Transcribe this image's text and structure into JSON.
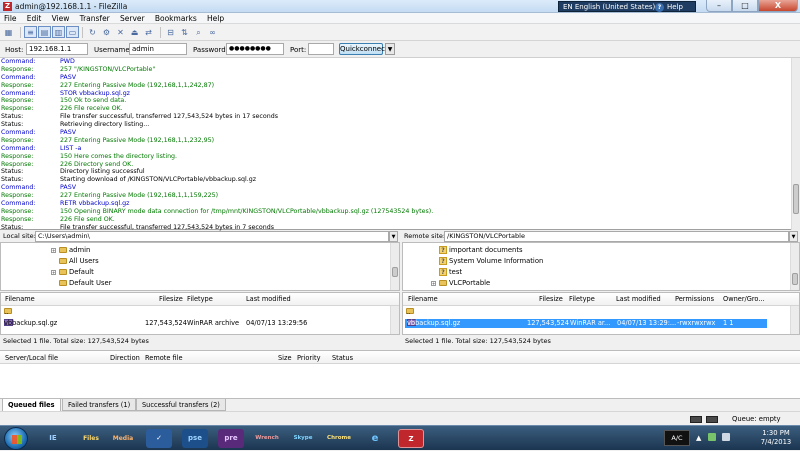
{
  "window": {
    "app_letter": "Z",
    "title": "admin@192.168.1.1 - FileZilla",
    "minimize": "–",
    "maximize": "□",
    "close": "X",
    "language": "EN English (United States)",
    "help": "Help",
    "help_q": "?"
  },
  "menu": [
    "File",
    "Edit",
    "View",
    "Transfer",
    "Server",
    "Bookmarks",
    "Help"
  ],
  "quickconnect": {
    "host_label": "Host:",
    "host": "192.168.1.1",
    "user_label": "Username:",
    "user": "admin",
    "pass_label": "Password:",
    "pass": "●●●●●●●●",
    "port_label": "Port:",
    "port": "",
    "button": "Quickconnect",
    "dropdown": "▼"
  },
  "log": [
    {
      "t": "Command:",
      "m": "PWD",
      "k": "command"
    },
    {
      "t": "Response:",
      "m": "257 \"/KINGSTON/VLCPortable\"",
      "k": "response"
    },
    {
      "t": "Command:",
      "m": "PASV",
      "k": "command"
    },
    {
      "t": "Response:",
      "m": "227 Entering Passive Mode (192,168,1,1,242,87)",
      "k": "response"
    },
    {
      "t": "Command:",
      "m": "STOR vbbackup.sql.gz",
      "k": "command"
    },
    {
      "t": "Response:",
      "m": "150 Ok to send data.",
      "k": "response"
    },
    {
      "t": "Response:",
      "m": "226 File receive OK.",
      "k": "response"
    },
    {
      "t": "Status:",
      "m": "File transfer successful, transferred 127,543,524 bytes in 17 seconds",
      "k": "status"
    },
    {
      "t": "Status:",
      "m": "Retrieving directory listing...",
      "k": "status"
    },
    {
      "t": "Command:",
      "m": "PASV",
      "k": "command"
    },
    {
      "t": "Response:",
      "m": "227 Entering Passive Mode (192,168,1,1,232,95)",
      "k": "response"
    },
    {
      "t": "Command:",
      "m": "LIST -a",
      "k": "command"
    },
    {
      "t": "Response:",
      "m": "150 Here comes the directory listing.",
      "k": "response"
    },
    {
      "t": "Response:",
      "m": "226 Directory send OK.",
      "k": "response"
    },
    {
      "t": "Status:",
      "m": "Directory listing successful",
      "k": "status"
    },
    {
      "t": "Status:",
      "m": "Starting download of /KINGSTON/VLCPortable/vbbackup.sql.gz",
      "k": "status"
    },
    {
      "t": "Command:",
      "m": "PASV",
      "k": "command"
    },
    {
      "t": "Response:",
      "m": "227 Entering Passive Mode (192,168,1,1,159,225)",
      "k": "response"
    },
    {
      "t": "Command:",
      "m": "RETR vbbackup.sql.gz",
      "k": "command"
    },
    {
      "t": "Response:",
      "m": "150 Opening BINARY mode data connection for /tmp/mnt/KINGSTON/VLCPortable/vbbackup.sql.gz (127543524 bytes).",
      "k": "response"
    },
    {
      "t": "Response:",
      "m": "226 File send OK.",
      "k": "response"
    },
    {
      "t": "Status:",
      "m": "File transfer successful, transferred 127,543,524 bytes in 7 seconds",
      "k": "status"
    }
  ],
  "local": {
    "site_label": "Local site:",
    "site_path": "C:\\Users\\admin\\",
    "tree": [
      "admin",
      "All Users",
      "Default",
      "Default User"
    ],
    "headers": [
      "Filename",
      "Filesize",
      "Filetype",
      "Last modified"
    ],
    "parent": "..",
    "files": [
      {
        "name": "vbbackup.sql.gz",
        "size": "127,543,524",
        "type": "WinRAR archive",
        "modified": "04/07/13 13:29:56"
      },
      {
        "name": "",
        "size": "",
        "type": "",
        "modified": ""
      }
    ],
    "status": "Selected 1 file. Total size: 127,543,524 bytes"
  },
  "remote": {
    "site_label": "Remote site:",
    "site_path": "/KINGSTON/VLCPortable",
    "tree": [
      "important documents",
      "System Volume Information",
      "test",
      "VLCPortable"
    ],
    "headers": [
      "Filename",
      "Filesize",
      "Filetype",
      "Last modified",
      "Permissions",
      "Owner/Gro..."
    ],
    "parent": "..",
    "files": [
      {
        "name": "vbbackup.sql.gz",
        "size": "127,543,524",
        "type": "WinRAR ar...",
        "modified": "04/07/13 13:29:...",
        "perm": "-rwxrwxrwx",
        "owner": "1 1"
      }
    ],
    "status": "Selected 1 file. Total size: 127,543,524 bytes"
  },
  "queue": {
    "headers": [
      "Server/Local file",
      "Direction",
      "Remote file",
      "Size",
      "Priority",
      "Status"
    ],
    "tabs": [
      "Queued files",
      "Failed transfers (1)",
      "Successful transfers (2)"
    ]
  },
  "statusbar": {
    "queue": "Queue: empty"
  },
  "taskbar": {
    "apps": [
      "IE",
      "Files",
      "Media",
      "✓",
      "pse",
      "pre",
      "Wrench",
      "Skype",
      "Chrome",
      "e",
      "Z"
    ],
    "ac": "A/C",
    "time": "1:30 PM",
    "date": "7/4/2013"
  },
  "colors": {
    "command": "#0000cc",
    "response": "#007a00",
    "selection": "#3399ff",
    "filezilla_red": "#c0272d"
  }
}
